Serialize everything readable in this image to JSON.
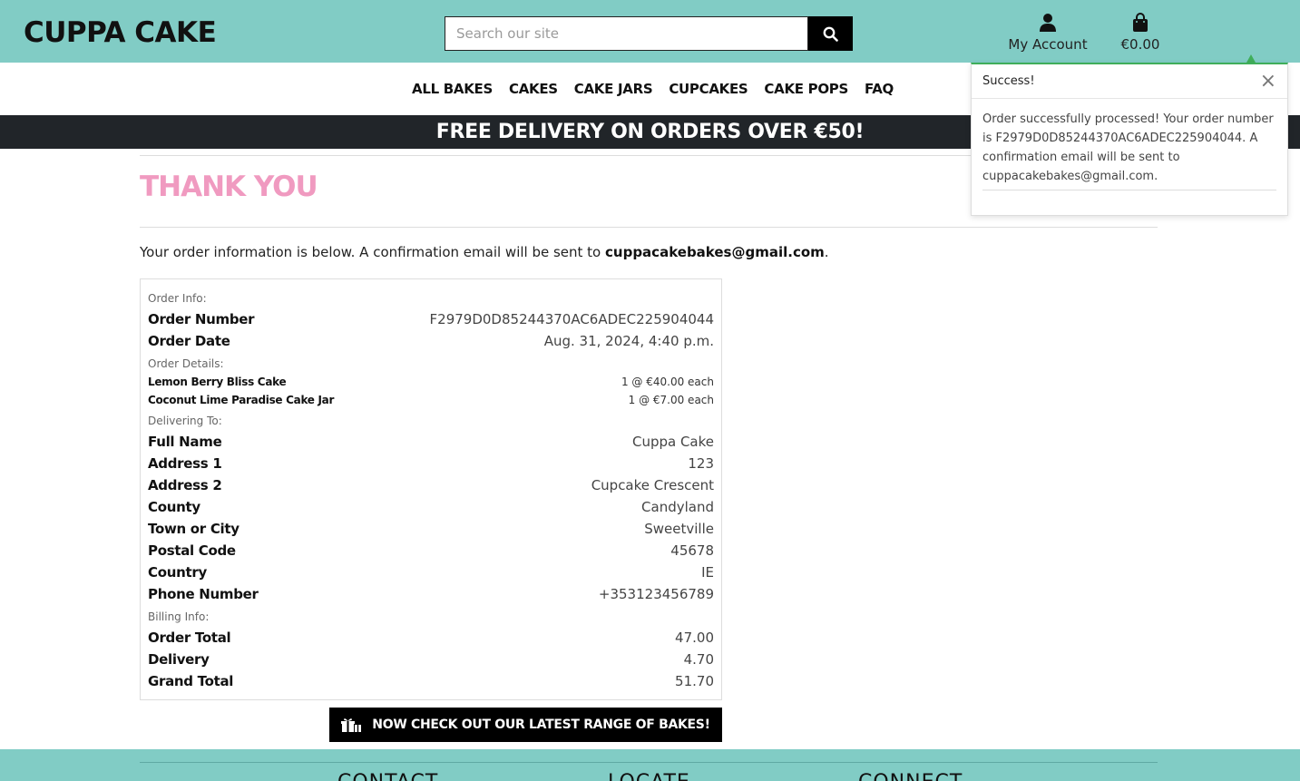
{
  "header": {
    "brand": "CUPPA CAKE",
    "search_placeholder": "Search our site",
    "account_label": "My Account",
    "bag_total": "€0.00"
  },
  "nav": {
    "items": [
      "ALL BAKES",
      "CAKES",
      "CAKE JARS",
      "CUPCAKES",
      "CAKE POPS",
      "FAQ"
    ]
  },
  "banner": "FREE DELIVERY ON ORDERS OVER €50!",
  "page": {
    "title": "THANK YOU",
    "intro_text": "Your order information is below. A confirmation email will be sent to ",
    "intro_email": "cuppacakebakes@gmail.com",
    "intro_end": "."
  },
  "order": {
    "info_heading": "Order Info:",
    "number_label": "Order Number",
    "number": "F2979D0D85244370AC6ADEC225904044",
    "date_label": "Order Date",
    "date": "Aug. 31, 2024, 4:40 p.m.",
    "details_heading": "Order Details:",
    "items": [
      {
        "name": "Lemon Berry Bliss Cake",
        "qty": "1 @ €40.00 each"
      },
      {
        "name": "Coconut Lime Paradise Cake Jar",
        "qty": "1 @ €7.00 each"
      }
    ],
    "delivering_heading": "Delivering To:",
    "delivery": [
      {
        "label": "Full Name",
        "value": "Cuppa Cake"
      },
      {
        "label": "Address 1",
        "value": "123"
      },
      {
        "label": "Address 2",
        "value": "Cupcake Crescent"
      },
      {
        "label": "County",
        "value": "Candyland"
      },
      {
        "label": "Town or City",
        "value": "Sweetville"
      },
      {
        "label": "Postal Code",
        "value": "45678"
      },
      {
        "label": "Country",
        "value": "IE"
      },
      {
        "label": "Phone Number",
        "value": "+353123456789"
      }
    ],
    "billing_heading": "Billing Info:",
    "billing": [
      {
        "label": "Order Total",
        "value": "47.00"
      },
      {
        "label": "Delivery",
        "value": "4.70"
      },
      {
        "label": "Grand Total",
        "value": "51.70"
      }
    ]
  },
  "cta_label": "NOW CHECK OUT OUR LATEST RANGE OF BAKES!",
  "footer": {
    "headings": [
      "CONTACT",
      "LOCATE",
      "CONNECT"
    ]
  },
  "toast": {
    "title": "Success!",
    "message": "Order successfully processed! Your order number is F2979D0D85244370AC6ADEC225904044. A confirmation email will be sent to cuppacakebakes@gmail.com."
  },
  "colors": {
    "header_bg": "#81ccc5",
    "title_pink": "#f09ac0",
    "banner_bg": "#212529",
    "toast_accent": "#3fae5a"
  }
}
